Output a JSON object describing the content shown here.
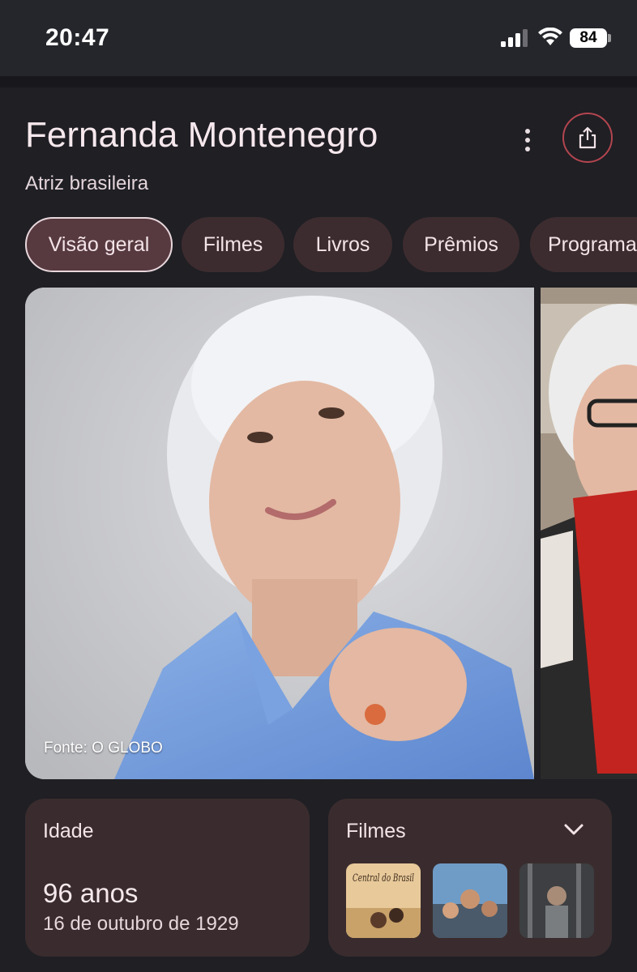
{
  "status_bar": {
    "time": "20:47",
    "battery": "84"
  },
  "header": {
    "title": "Fernanda Montenegro",
    "subtitle": "Atriz brasileira",
    "more_icon": "more-vert-icon",
    "share_icon": "share-icon"
  },
  "chips": [
    {
      "label": "Visão geral",
      "active": true
    },
    {
      "label": "Filmes",
      "active": false
    },
    {
      "label": "Livros",
      "active": false
    },
    {
      "label": "Prêmios",
      "active": false
    },
    {
      "label": "Programa",
      "active": false
    }
  ],
  "images": {
    "credit": "Fonte: O GLOBO"
  },
  "age_card": {
    "label": "Idade",
    "value": "96 anos",
    "birth_date": "16 de outubro de 1929"
  },
  "films_card": {
    "label": "Filmes",
    "thumb_1_title": "Central do Brasil",
    "chevron_icon": "chevron-down-icon"
  },
  "colors": {
    "background": "#1f1f24",
    "chip": "#3d2c2f",
    "chip_active": "#573a40",
    "card": "#3a2c2e",
    "share_ring": "#b3454f"
  }
}
